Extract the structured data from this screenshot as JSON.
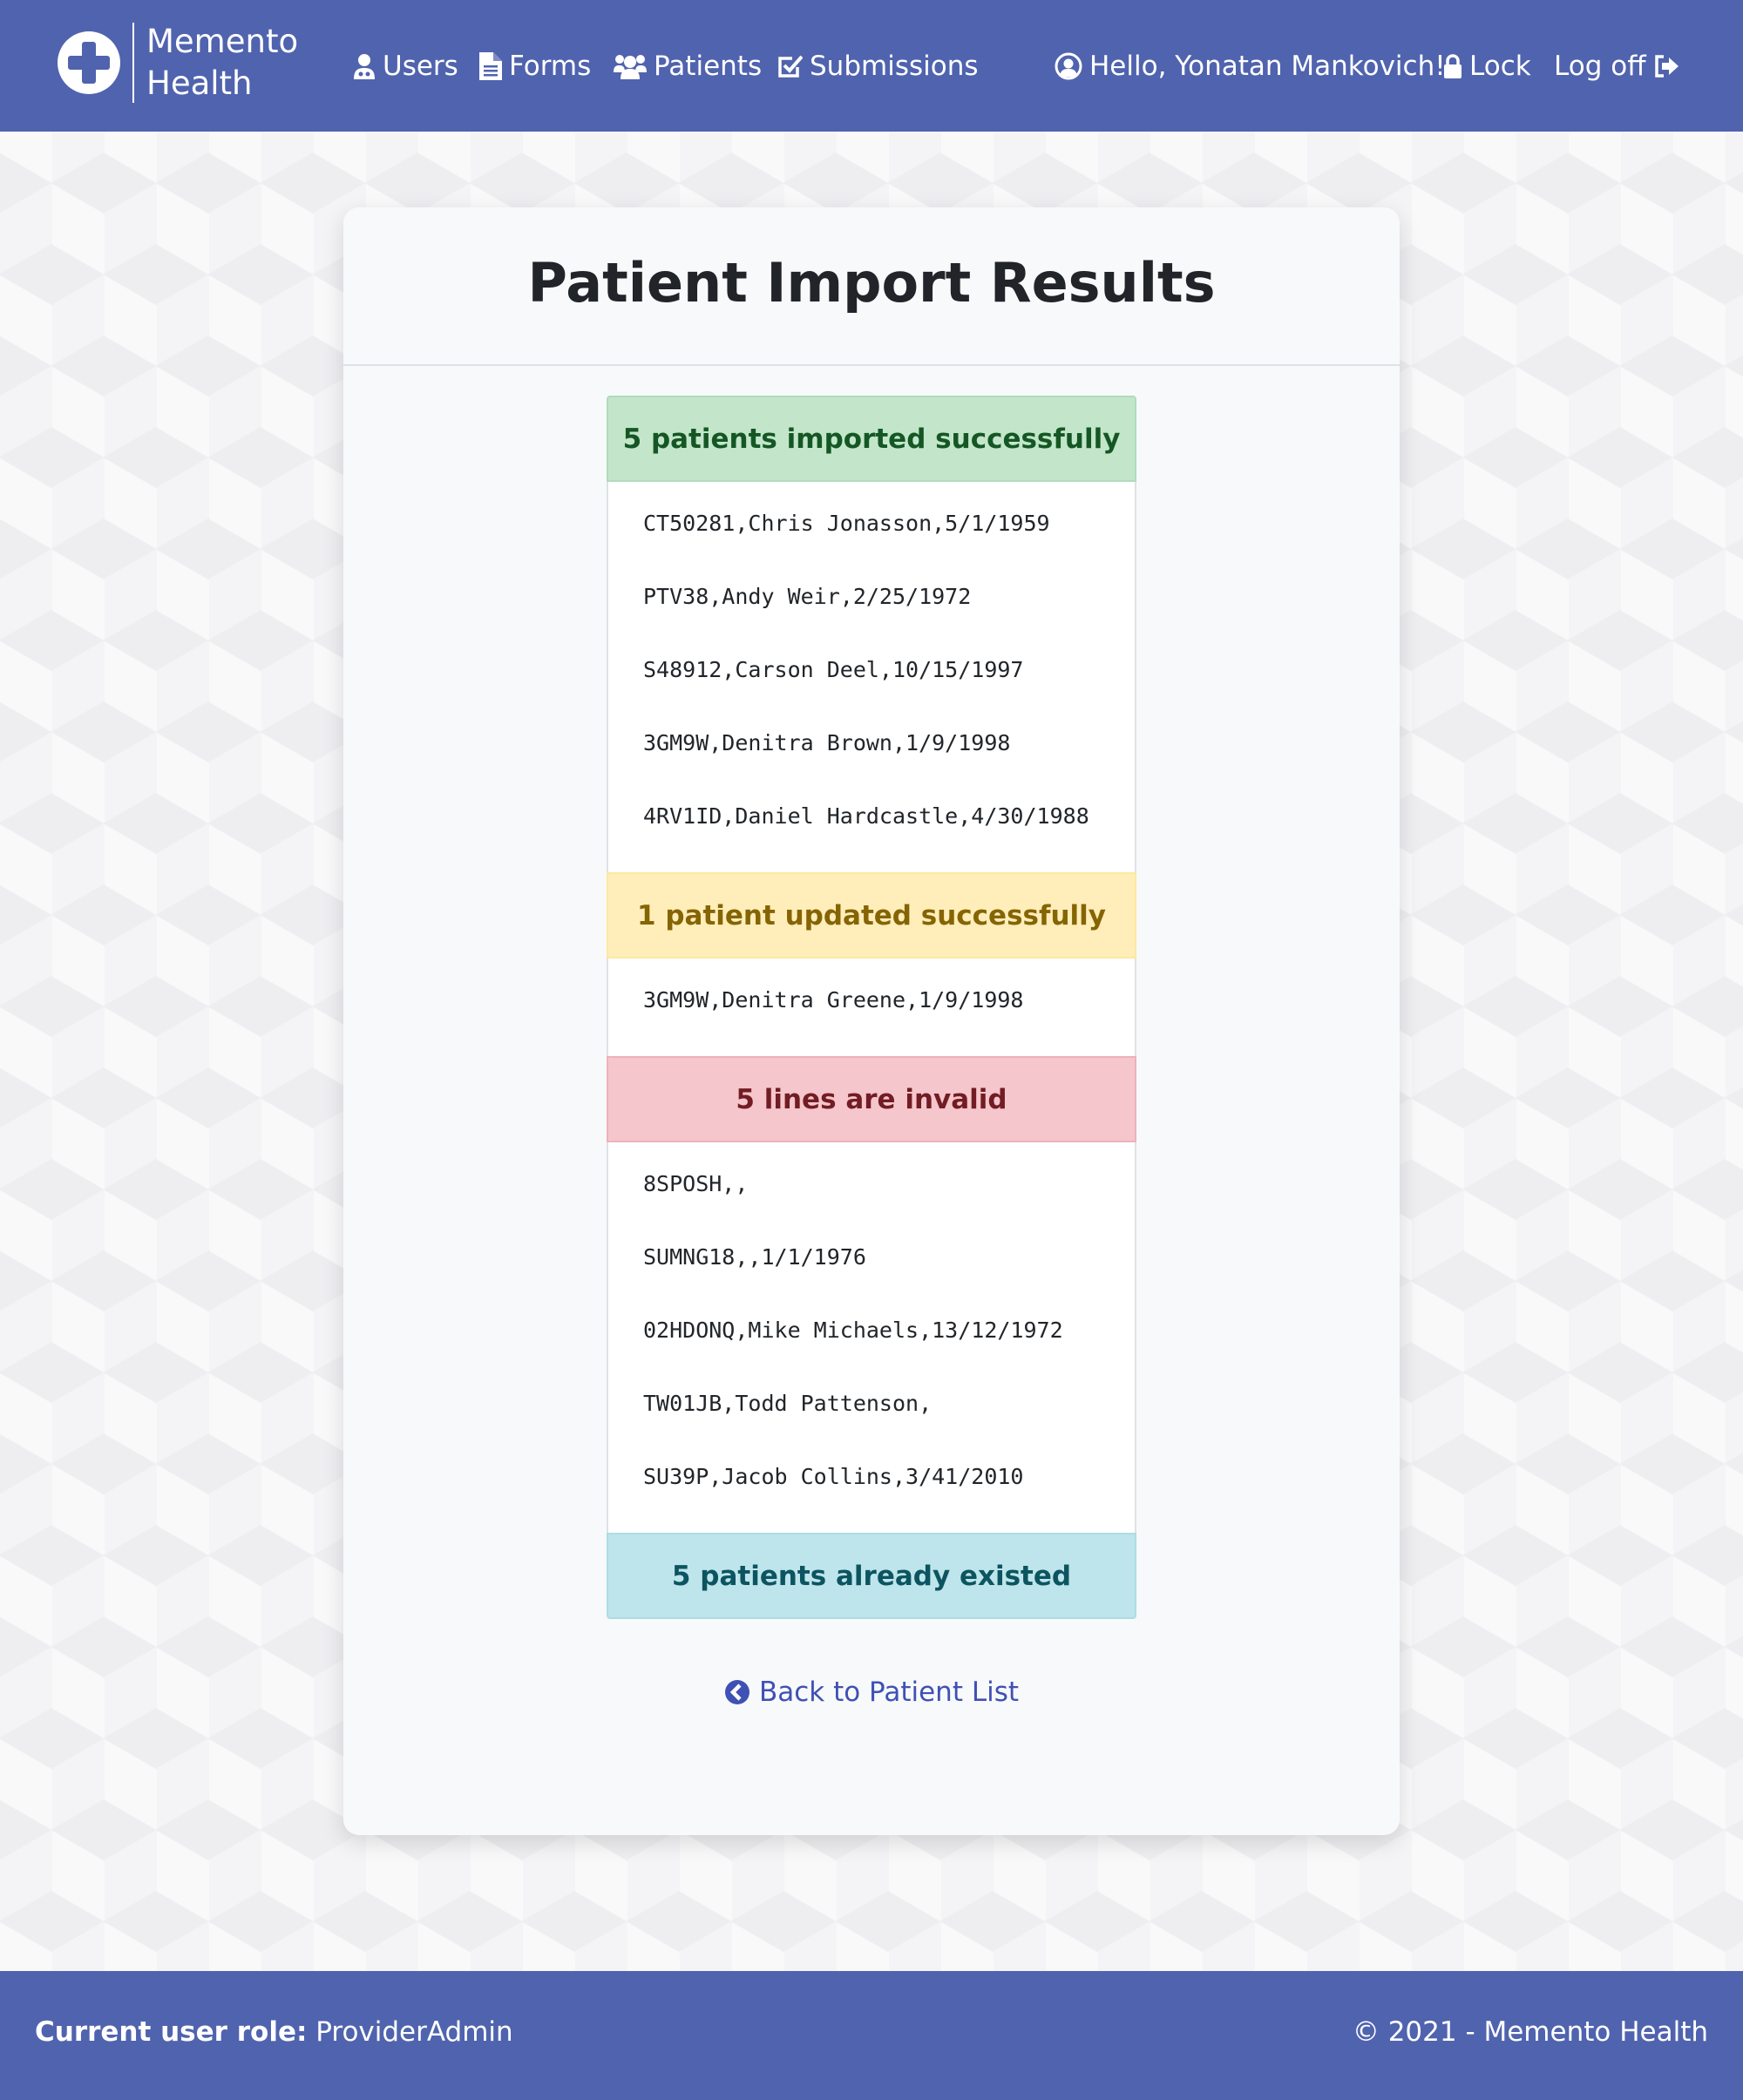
{
  "brand": {
    "line1": "Memento",
    "line2": "Health"
  },
  "nav": {
    "users": "Users",
    "forms": "Forms",
    "patients": "Patients",
    "submissions": "Submissions",
    "greeting": "Hello, Yonatan Mankovich!",
    "lock": "Lock",
    "logoff": "Log off"
  },
  "page": {
    "title": "Patient Import Results"
  },
  "results": {
    "imported": {
      "header": "5 patients imported successfully",
      "lines": [
        "CT50281,Chris Jonasson,5/1/1959",
        "PTV38,Andy Weir,2/25/1972",
        "S48912,Carson Deel,10/15/1997",
        "3GM9W,Denitra Brown,1/9/1998",
        "4RV1ID,Daniel Hardcastle,4/30/1988"
      ]
    },
    "updated": {
      "header": "1 patient updated successfully",
      "lines": [
        "3GM9W,Denitra Greene,1/9/1998"
      ]
    },
    "invalid": {
      "header": "5 lines are invalid",
      "lines": [
        "8SPOSH,,",
        "SUMNG18,,1/1/1976",
        "02HDONQ,Mike Michaels,13/12/1972",
        "TW01JB,Todd Pattenson,",
        "SU39P,Jacob Collins,3/41/2010"
      ]
    },
    "existed": {
      "header": "5 patients already existed"
    }
  },
  "back_link": "Back to Patient List",
  "footer": {
    "role_label": "Current user role:",
    "role_value": "ProviderAdmin",
    "copyright": "© 2021 - Memento Health"
  },
  "colors": {
    "primary": "#5063ae",
    "success_bg": "#c3e6cb",
    "warning_bg": "#ffeeba",
    "danger_bg": "#f5c6cb",
    "info_bg": "#bee5eb",
    "link": "#3f51b5"
  },
  "icons": {
    "brand": "medical-cross-icon",
    "users": "user-doctor-icon",
    "forms": "file-text-icon",
    "patients": "users-group-icon",
    "submissions": "check-square-icon",
    "greeting": "user-circle-icon",
    "lock": "lock-icon",
    "logoff": "sign-out-icon",
    "back": "chevron-circle-left-icon"
  }
}
